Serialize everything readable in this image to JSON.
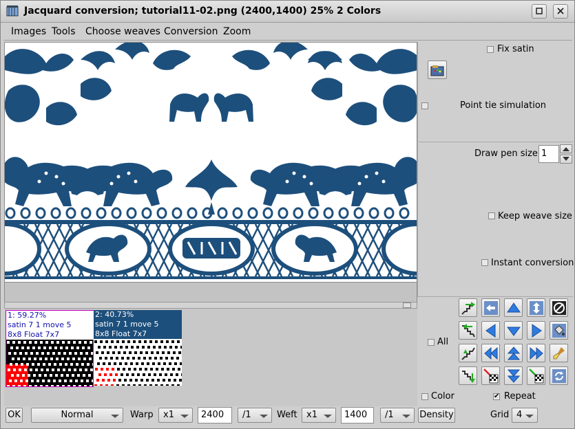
{
  "window": {
    "title": "Jacquard conversion; tutorial11-02.png (2400,1400) 25% 2 Colors"
  },
  "menu": [
    "Images",
    "Tools",
    "Choose weaves",
    "Conversion",
    "Zoom"
  ],
  "right_panel": {
    "fix_satin": "Fix satin",
    "point_tie": "Point tie simulation",
    "draw_pen_size_label": "Draw pen size",
    "draw_pen_size_value": "1",
    "keep_weave_size": "Keep weave size",
    "instant_conversion": "Instant conversion",
    "all": "All",
    "color": "Color",
    "repeat": "Repeat",
    "repeat_checked": true
  },
  "weaves": [
    {
      "percent": "1: 59.27%",
      "line2": "satin 7 1 move 5",
      "line3": "8x8 Float 7x7"
    },
    {
      "percent": "2: 40.73%",
      "line2": "satin 7 1 move 5",
      "line3": "8x8 Float 7x7"
    }
  ],
  "bottom": {
    "ok": "OK",
    "mode": "Normal",
    "warp_label": "Warp",
    "warp_mult": "x1",
    "warp_value": "2400",
    "warp_div": "/1",
    "weft_label": "Weft",
    "weft_mult": "x1",
    "weft_value": "1400",
    "weft_div": "/1",
    "density": "Density",
    "grid_label": "Grid",
    "grid_value": "4"
  },
  "colors": {
    "pattern": "#1d4f7c",
    "accent_magenta": "#c000c0",
    "weave_red": "#ff0000"
  }
}
